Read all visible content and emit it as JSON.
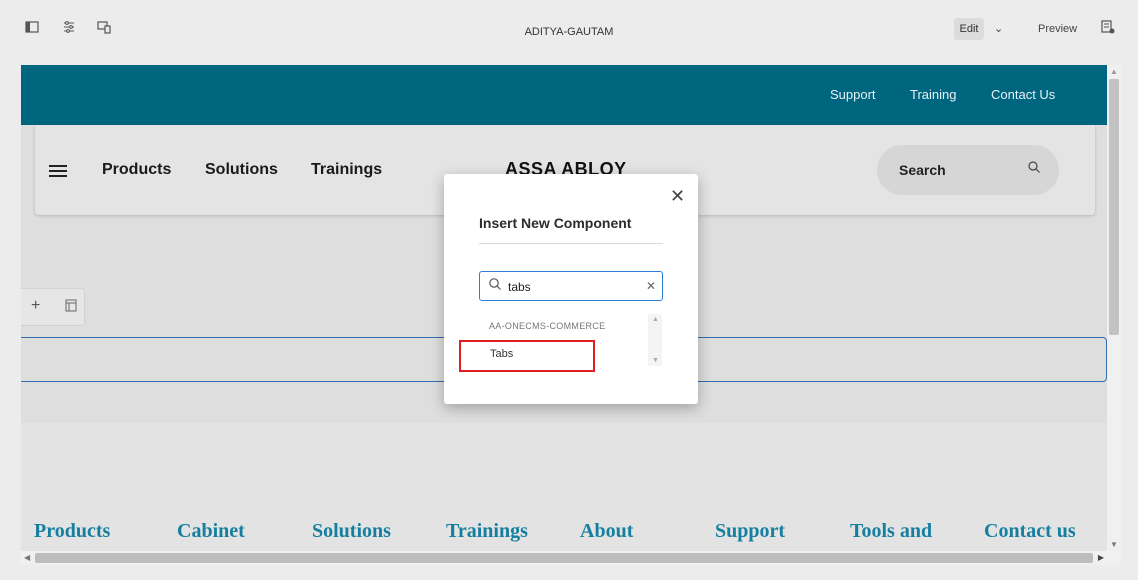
{
  "toolbar": {
    "title": "ADITYA-GAUTAM",
    "edit_label": "Edit",
    "preview_label": "Preview"
  },
  "site": {
    "utility_links": [
      "Support",
      "Training",
      "Contact Us"
    ],
    "nav_links": [
      "Products",
      "Solutions",
      "Trainings"
    ],
    "logo_text": "ASSA ABLOY",
    "search_label": "Search",
    "footer_links": [
      "Products",
      "Cabinet",
      "Solutions",
      "Trainings",
      "About",
      "Support",
      "Tools and",
      "Contact us"
    ]
  },
  "dialog": {
    "title": "Insert New Component",
    "search_value": "tabs",
    "group_label": "AA-ONECMS-COMMERCE",
    "items": [
      "Tabs"
    ]
  },
  "colors": {
    "topbar": "#00657f",
    "footer_link": "#157fa0",
    "drop_zone_border": "#2f6fb3",
    "search_focus": "#2f7dd6",
    "highlight": "#e02020"
  }
}
